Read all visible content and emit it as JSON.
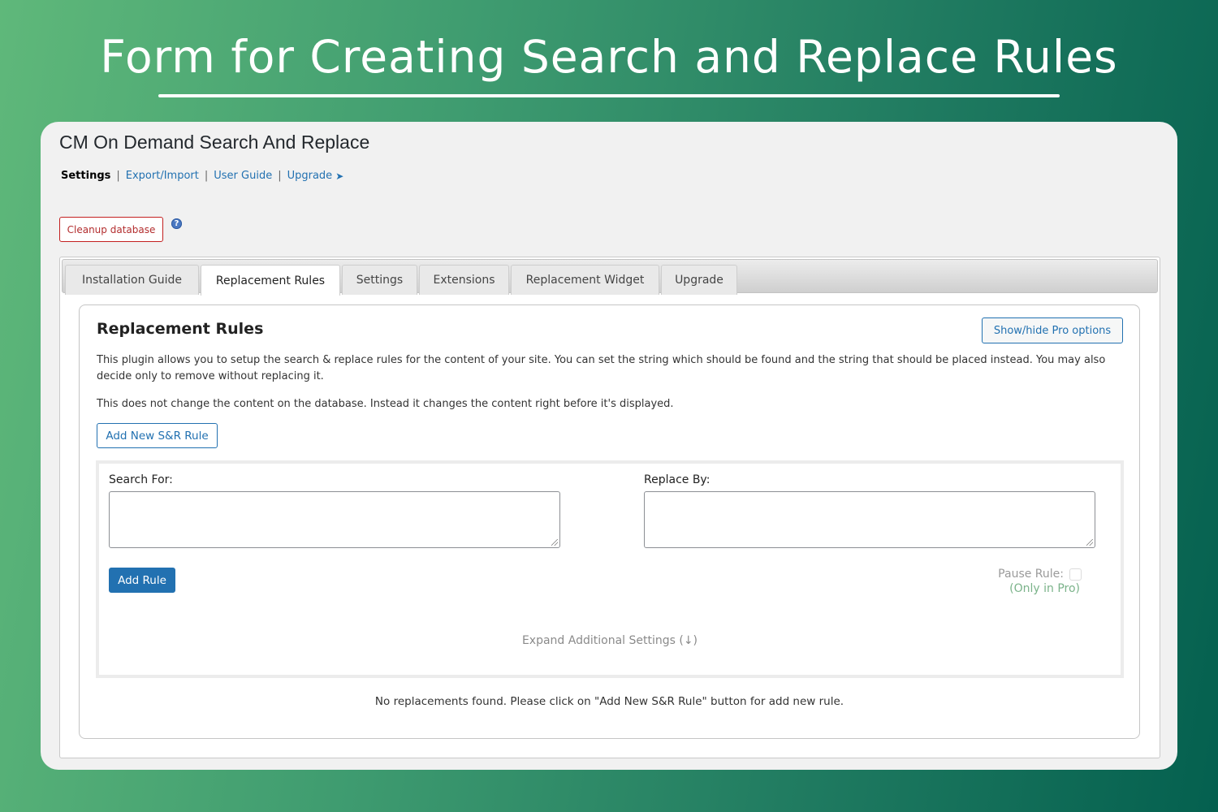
{
  "banner": {
    "title": "Form for Creating Search and Replace Rules"
  },
  "app": {
    "title": "CM On Demand Search And Replace",
    "subnav": {
      "current": "Settings",
      "links": [
        "Export/Import",
        "User Guide",
        "Upgrade"
      ],
      "separator": "|"
    },
    "cleanup_button": "Cleanup database",
    "help_icon": "question-icon"
  },
  "tabs": [
    {
      "label": "Installation Guide",
      "active": false
    },
    {
      "label": "Replacement Rules",
      "active": true
    },
    {
      "label": "Settings",
      "active": false
    },
    {
      "label": "Extensions",
      "active": false
    },
    {
      "label": "Replacement Widget",
      "active": false
    },
    {
      "label": "Upgrade",
      "active": false
    }
  ],
  "panel": {
    "heading": "Replacement Rules",
    "pro_button": "Show/hide Pro options",
    "description_1": "This plugin allows you to setup the search & replace rules for the content of your site. You can set the string which should be found and the string that should be placed instead. You may also decide only to remove without replacing it.",
    "description_2": "This does not change the content on the database. Instead it changes the content right before it's displayed.",
    "add_new_button": "Add New S&R Rule",
    "form": {
      "search_label": "Search For:",
      "search_value": "",
      "replace_label": "Replace By:",
      "replace_value": "",
      "add_rule_button": "Add Rule",
      "pause_label": "Pause Rule:",
      "pause_checked": false,
      "pro_note": "(Only in Pro)",
      "expand_link": "Expand Additional Settings (↓)"
    },
    "empty_message": "No replacements found. Please click on \"Add New S&R Rule\" button for add new rule."
  },
  "colors": {
    "accent": "#2271b1",
    "danger": "#b32d2e",
    "pro_note": "#7bb38a"
  }
}
